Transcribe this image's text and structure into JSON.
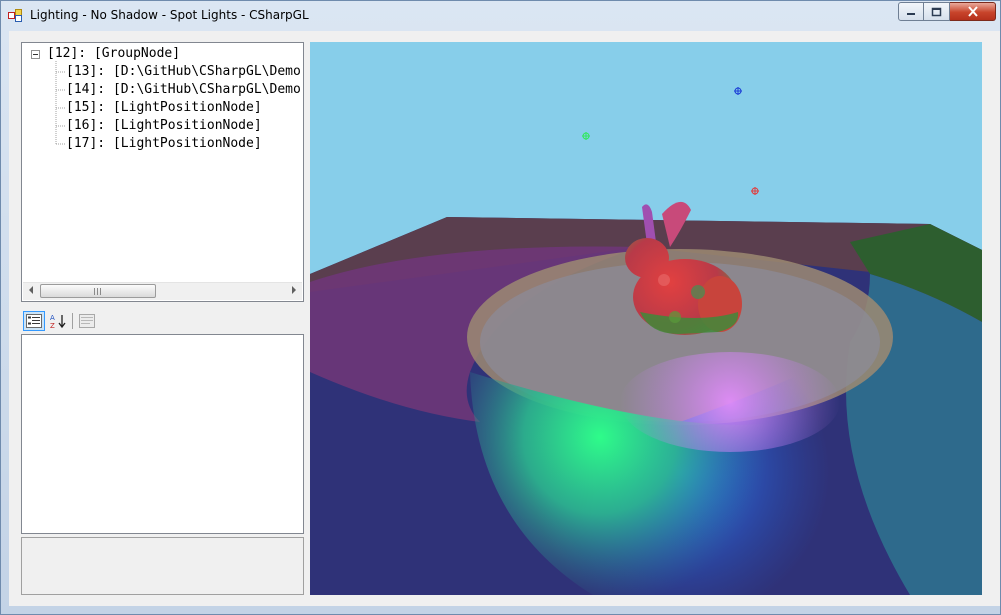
{
  "window": {
    "title": "Lighting - No Shadow - Spot Lights - CSharpGL",
    "colors": {
      "frame": "#c3d3e6",
      "close": "#c8442b",
      "client": "#f0f0f0"
    }
  },
  "tree": {
    "root_label": "[12]: [GroupNode]",
    "children": [
      {
        "label": "[13]: [D:\\GitHub\\CSharpGL\\Demo"
      },
      {
        "label": "[14]: [D:\\GitHub\\CSharpGL\\Demo"
      },
      {
        "label": "[15]: [LightPositionNode]"
      },
      {
        "label": "[16]: [LightPositionNode]"
      },
      {
        "label": "[17]: [LightPositionNode]"
      }
    ],
    "scroll_grip": "III"
  },
  "property_grid": {
    "categorized_icon": "categorized-icon",
    "alphabetical_icon": "sort-az-icon",
    "pages_icon": "property-pages-icon"
  },
  "scene": {
    "sky_color": "#87ceea",
    "light_markers": [
      {
        "name": "green-light-marker",
        "color": "#2ee85a"
      },
      {
        "name": "blue-light-marker",
        "color": "#1a3cd6"
      },
      {
        "name": "red-light-marker",
        "color": "#e23a3a"
      }
    ],
    "model": "bunny"
  }
}
